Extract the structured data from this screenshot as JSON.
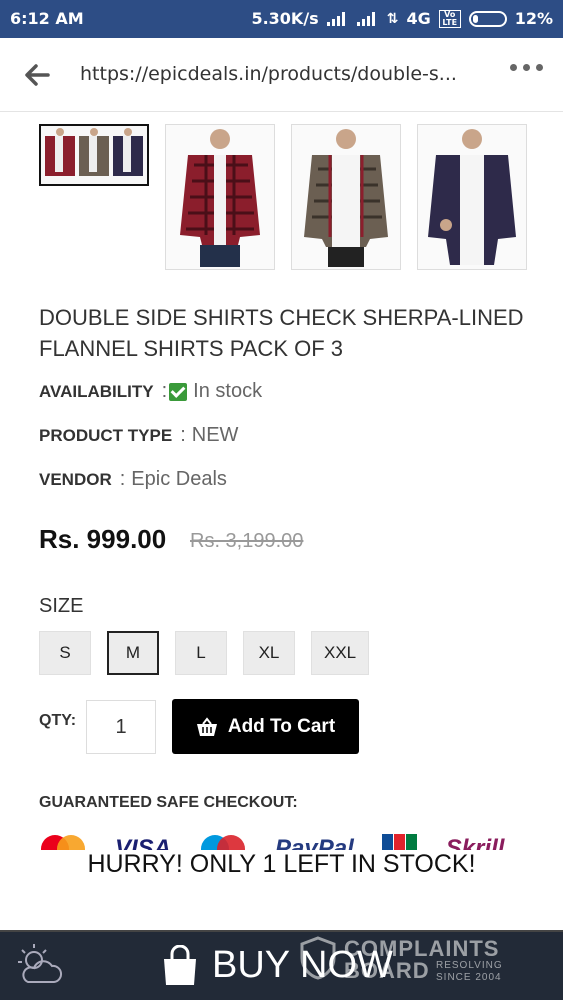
{
  "status": {
    "time": "6:12 AM",
    "speed": "5.30K/s",
    "network": "4G",
    "volte": "Vo LTE",
    "battery": "12%"
  },
  "browser": {
    "url": "https://epicdeals.in/products/double-s..."
  },
  "product": {
    "title": "DOUBLE SIDE SHIRTS CHECK SHERPA-LINED FLANNEL SHIRTS PACK OF 3",
    "availability_label": "AVAILABILITY",
    "availability_value": "In stock",
    "type_label": "PRODUCT TYPE",
    "type_value": "NEW",
    "vendor_label": "VENDOR",
    "vendor_value": "Epic Deals",
    "separator": ":",
    "price": "Rs. 999.00",
    "old_price": "Rs. 3,199.00"
  },
  "size": {
    "label": "SIZE",
    "options": [
      "S",
      "M",
      "L",
      "XL",
      "XXL"
    ],
    "selected": "M"
  },
  "purchase": {
    "qty_label": "QTY:",
    "qty_value": "1",
    "add_to_cart": "Add To Cart"
  },
  "checkout": {
    "label": "GUARANTEED SAFE CHECKOUT:",
    "brands": [
      "VISA",
      "PayPal",
      "Skrill"
    ]
  },
  "banner": {
    "hurry": "HURRY! ONLY 1 LEFT IN STOCK!"
  },
  "buy_bar": {
    "buy_now": "BUY NOW",
    "watermark_line1": "COMPLAINTS",
    "watermark_line2": "BOARD",
    "watermark_line3": "RESOLVING",
    "watermark_line4": "SINCE 2004"
  },
  "colors": {
    "status_bar": "#2d4d85",
    "accent_check": "#3a9a3a",
    "button_black": "#000000",
    "buy_bar": "#222a37"
  }
}
